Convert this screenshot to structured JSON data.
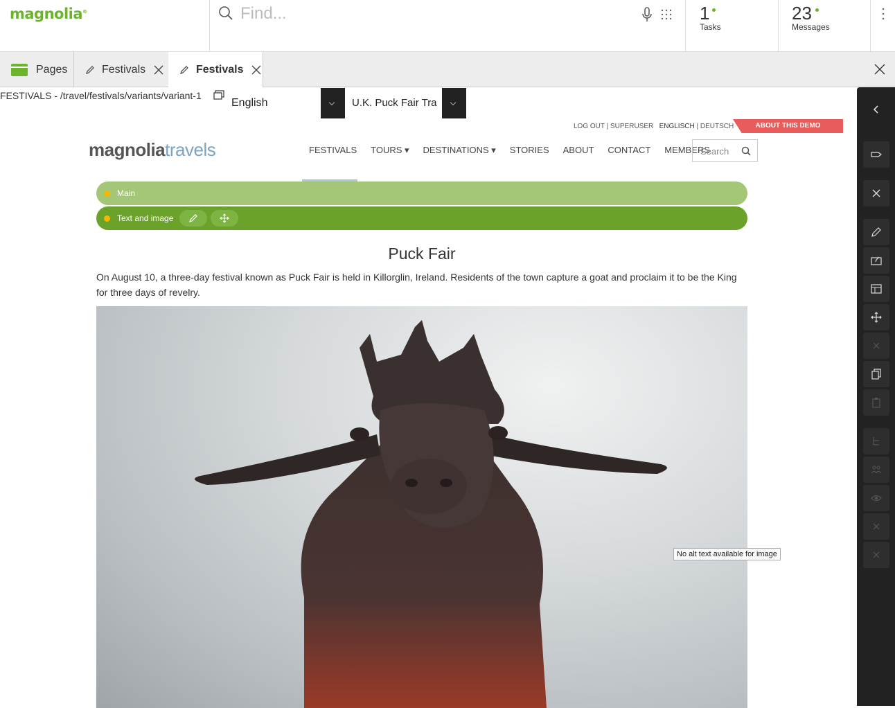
{
  "app": {
    "logo": "magnolia",
    "search_placeholder": "Find...",
    "tasks": {
      "count": "1",
      "label": "Tasks"
    },
    "messages": {
      "count": "23",
      "label": "Messages"
    }
  },
  "tabs": [
    {
      "label": "Pages",
      "icon": "pages-icon"
    },
    {
      "label": "Festivals",
      "icon": "pencil-icon"
    },
    {
      "label": "Festivals",
      "icon": "pencil-icon",
      "active": true
    }
  ],
  "editor": {
    "path": "FESTIVALS - /travel/festivals/variants/variant-1",
    "language": "English",
    "variant": "U.K. Puck Fair Tra .."
  },
  "site": {
    "util_links": {
      "logout": "LOG OUT",
      "user": "SUPERUSER",
      "lang_en": "ENGLISCH",
      "lang_de": "DEUTSCH"
    },
    "about_demo": "ABOUT THIS DEMO",
    "logo_main": "magnolia",
    "logo_accent": "travels",
    "nav": [
      "FESTIVALS",
      "TOURS",
      "DESTINATIONS",
      "STORIES",
      "ABOUT",
      "CONTACT",
      "MEMBERS"
    ],
    "search_placeholder": "Search"
  },
  "areas": {
    "main_label": "Main",
    "component_label": "Text and image"
  },
  "article": {
    "title": "Puck Fair",
    "body": "On August 10, a three-day festival known as Puck Fair is held in Killorglin, Ireland. Residents of the town capture a goat and proclaim it to be the King for three days of revelry.",
    "image_tooltip": "No alt text available for image"
  },
  "colors": {
    "brand_green": "#6cb42d",
    "area_light": "#a3c776",
    "area_dark": "#6aa22a",
    "about_red": "#e85c5c",
    "dark_bar": "#222222"
  }
}
